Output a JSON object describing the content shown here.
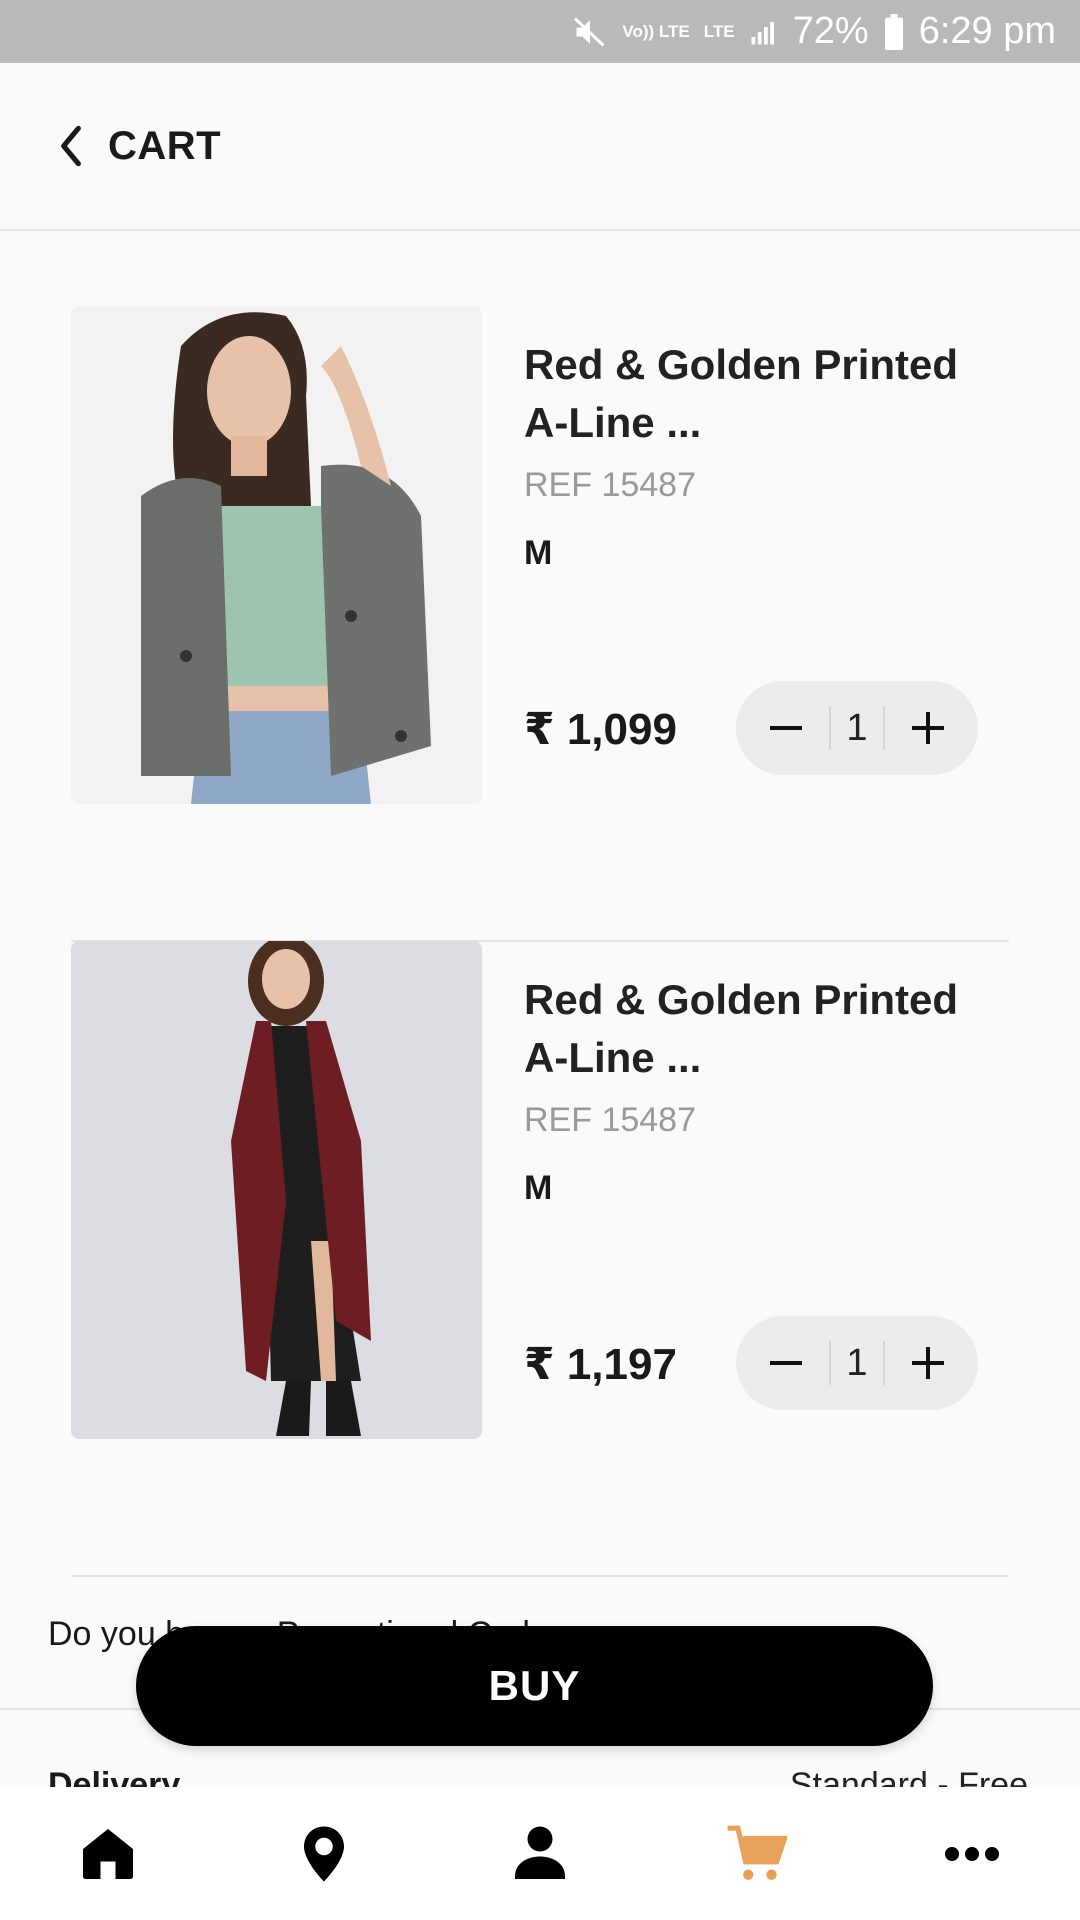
{
  "status_bar": {
    "volte": "Vo)) LTE",
    "lte": "LTE",
    "battery": "72%",
    "time": "6:29 pm"
  },
  "header": {
    "title": "CART"
  },
  "cart_items": [
    {
      "name": "Red & Golden Printed A-Line ...",
      "ref": "REF 15487",
      "size": "M",
      "price": "₹ 1,099",
      "quantity": "1",
      "image": "woman in grey jacket and green crop top"
    },
    {
      "name": "Red & Golden Printed A-Line ...",
      "ref": "REF 15487",
      "size": "M",
      "price": "₹ 1,197",
      "quantity": "1",
      "image": "woman in maroon long shrug and black dress"
    }
  ],
  "promo_question": "Do you have a Promotional Code",
  "delivery": {
    "label": "Delivery",
    "value": "Standard - Free"
  },
  "buy_button": "BUY",
  "bottom_nav": [
    {
      "icon": "home-icon",
      "active": false
    },
    {
      "icon": "location-icon",
      "active": false
    },
    {
      "icon": "profile-icon",
      "active": false
    },
    {
      "icon": "cart-icon",
      "active": true
    },
    {
      "icon": "more-icon",
      "active": false
    }
  ],
  "colors": {
    "accent": "#e8a15a",
    "button": "#000000",
    "status_bar": "#b9b9b9"
  }
}
